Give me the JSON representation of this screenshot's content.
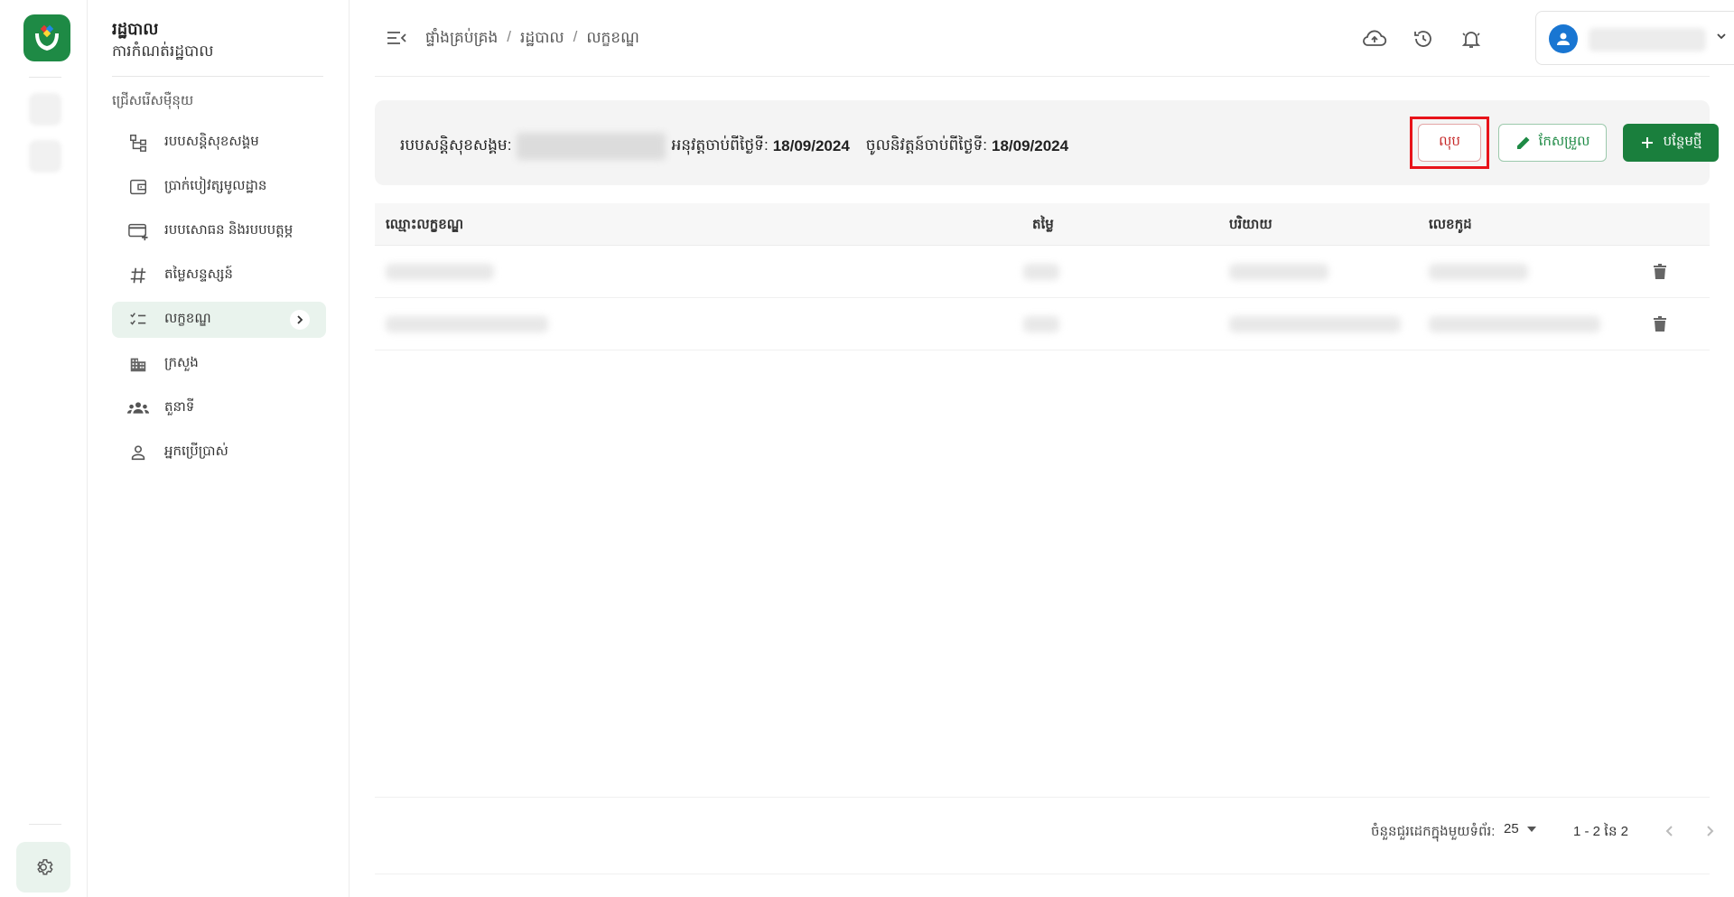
{
  "sidebar": {
    "title": "រដ្ឋបាល",
    "subtitle": "ការកំណត់រដ្ឋបាល",
    "section": "ជ្រើសរើសម៉ឺនុយ",
    "items": [
      {
        "label": "របបសន្តិសុខសង្គម",
        "icon": "hierarchy-icon"
      },
      {
        "label": "ប្រាក់បៀវត្សមូលដ្ឋាន",
        "icon": "wallet-icon"
      },
      {
        "label": "របបសោធន និងរបបបត្តម្ភ",
        "icon": "card-add-icon"
      },
      {
        "label": "តម្លៃសន្ទស្សន៍",
        "icon": "hash-icon"
      },
      {
        "label": "លក្ខខណ្ឌ",
        "icon": "checklist-icon",
        "active": true
      },
      {
        "label": "ក្រសួង",
        "icon": "building-icon"
      },
      {
        "label": "តួនាទី",
        "icon": "group-icon"
      },
      {
        "label": "អ្នកប្រើប្រាស់",
        "icon": "person-icon"
      }
    ]
  },
  "breadcrumb": [
    "ផ្ទាំងគ្រប់គ្រង",
    "រដ្ឋបាល",
    "លក្ខខណ្ឌ"
  ],
  "info": {
    "scheme_label": "របបសន្តិសុខសង្គម:",
    "effective_label": "អនុវត្តចាប់ពីថ្ងៃទី:",
    "effective_date": "18/09/2024",
    "entry_label": "ចូលនិវត្តន៍ចាប់ពីថ្ងៃទី:",
    "entry_date": "18/09/2024"
  },
  "actions": {
    "delete": "លុប",
    "edit": "កែសម្រួល",
    "add": "បន្ថែមថ្មី"
  },
  "table": {
    "columns": [
      "ឈ្មោះលក្ខខណ្ឌ",
      "តម្លៃ",
      "បរិយាយ",
      "លេខកូដ"
    ]
  },
  "pagination": {
    "rows_label": "ចំនួនជួរដេកក្នុងមួយទំព័រ:",
    "rows_per_page": "25",
    "range": "1 - 2 នៃ 2"
  },
  "colors": {
    "brand": "#1e8a45",
    "danger": "#c62828",
    "highlight": "#e8131a"
  }
}
